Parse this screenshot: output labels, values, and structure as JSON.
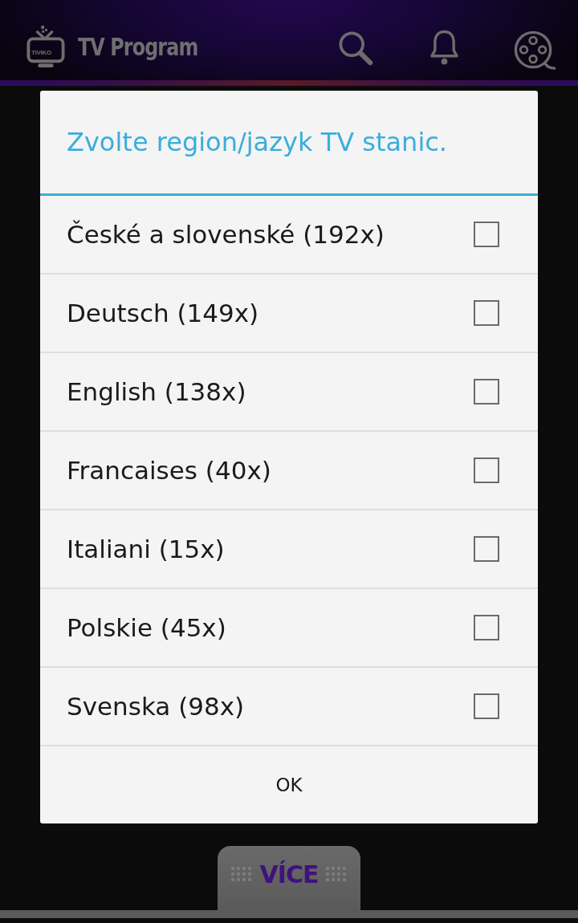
{
  "app_bar": {
    "logo_text": "TIVIKO",
    "title": "TV Program"
  },
  "dialog": {
    "title": "Zvolte region/jazyk TV stanic.",
    "options": [
      {
        "label": "České a slovenské (192x)",
        "checked": false
      },
      {
        "label": "Deutsch (149x)",
        "checked": false
      },
      {
        "label": "English (138x)",
        "checked": false
      },
      {
        "label": "Francaises (40x)",
        "checked": false
      },
      {
        "label": "Italiani (15x)",
        "checked": false
      },
      {
        "label": "Polskie (45x)",
        "checked": false
      },
      {
        "label": "Svenska (98x)",
        "checked": false
      }
    ],
    "button": "OK"
  },
  "bottom_tab": {
    "label": "VÍCE"
  }
}
